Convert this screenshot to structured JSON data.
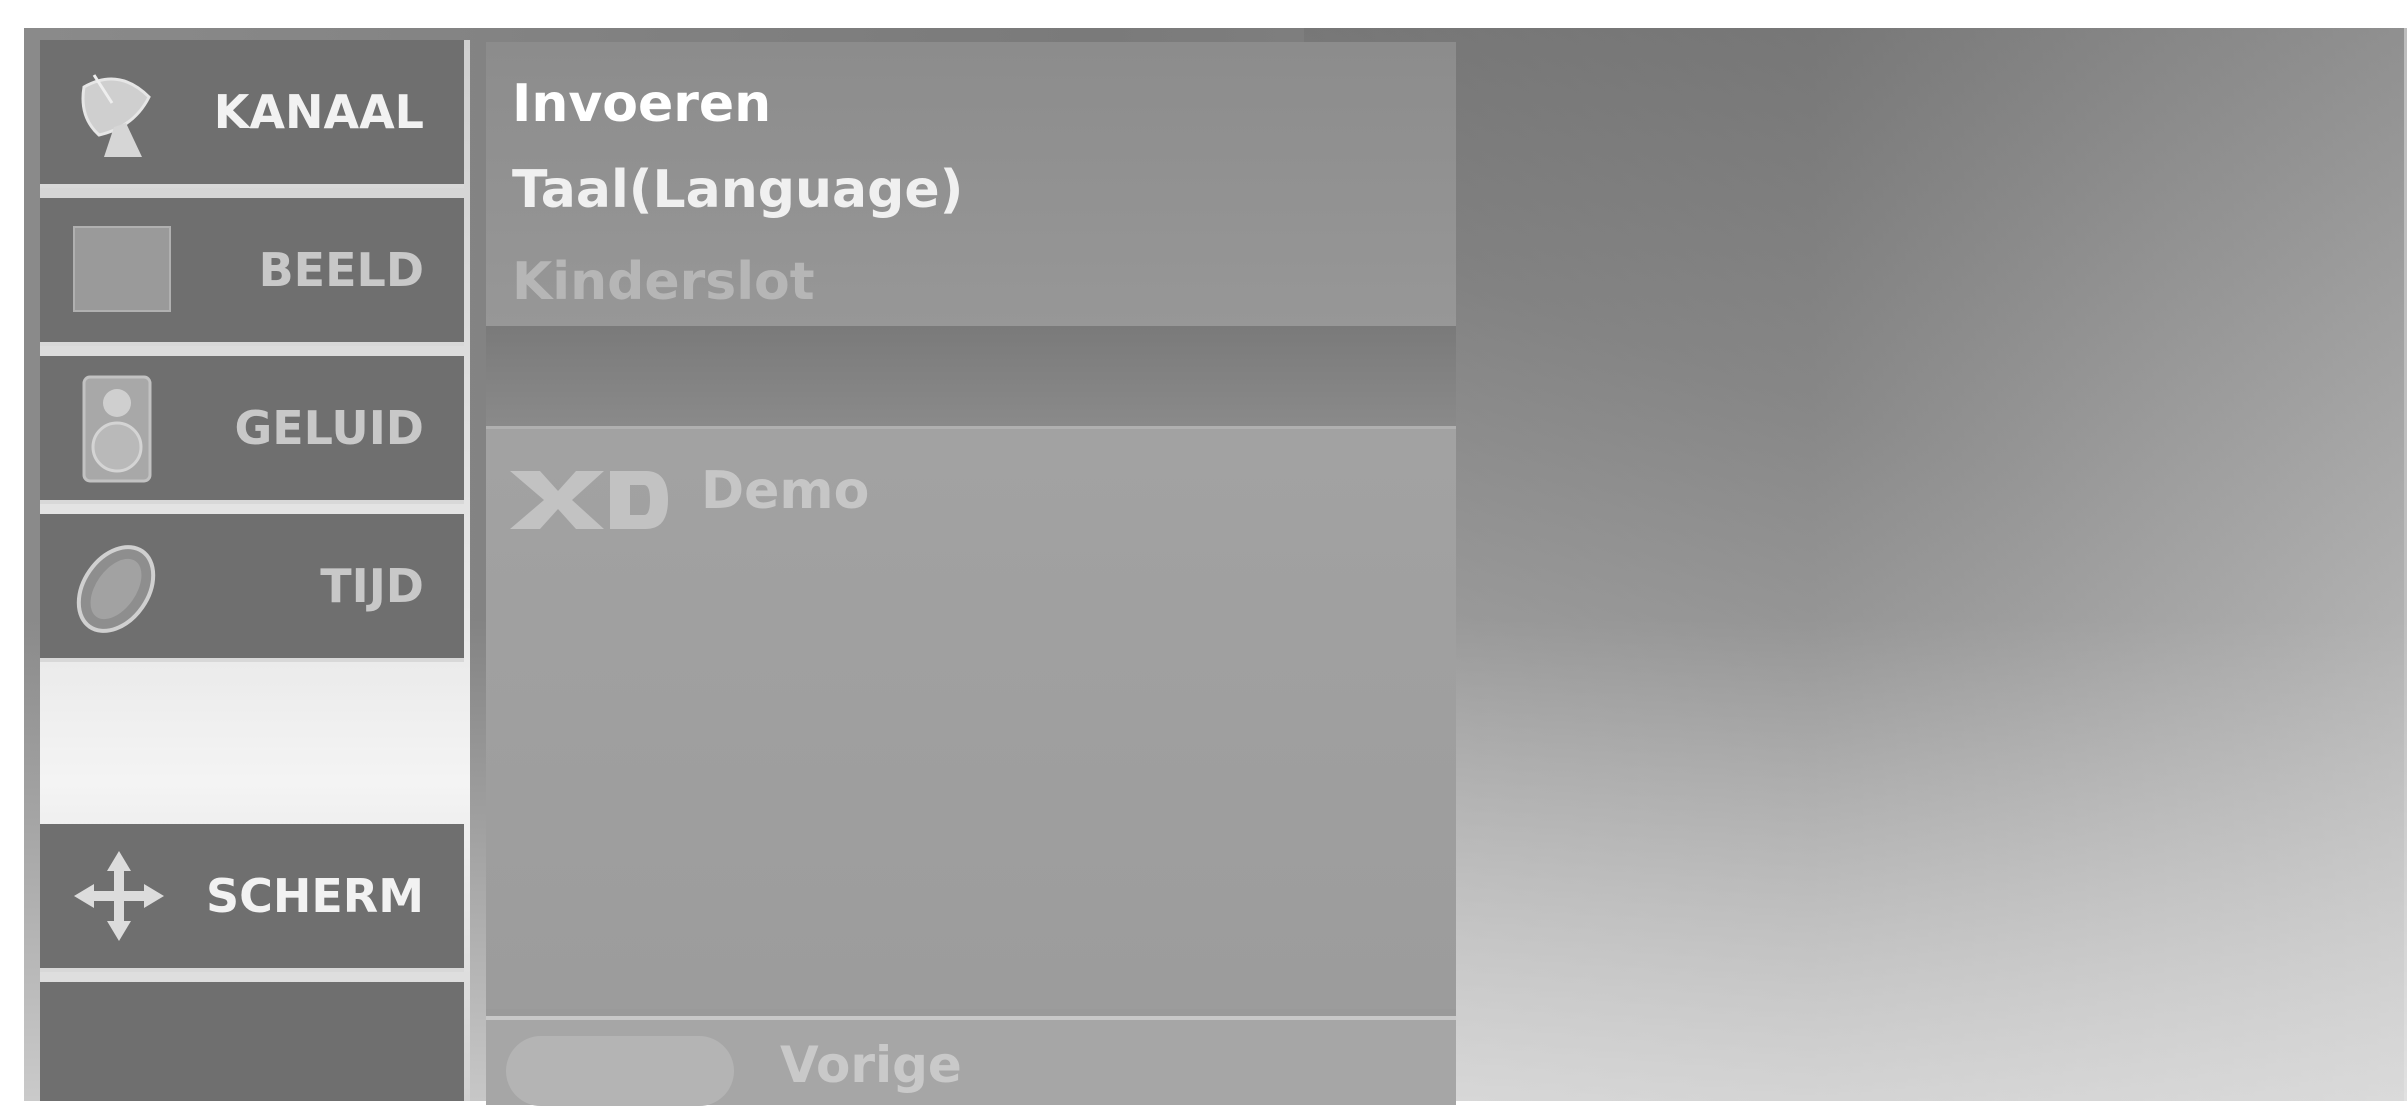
{
  "sidebar": {
    "items": [
      {
        "label": "KANAAL",
        "icon": "satellite-dish-icon"
      },
      {
        "label": "BEELD",
        "icon": "picture-square-icon"
      },
      {
        "label": "GELUID",
        "icon": "speaker-icon"
      },
      {
        "label": "TIJD",
        "icon": "clock-globe-icon"
      },
      {
        "label": "SCHERM",
        "icon": "move-arrows-icon"
      }
    ]
  },
  "submenu": {
    "items": [
      "Invoeren",
      "Taal(Language)",
      "Kinderslot"
    ],
    "demo_label": "Demo",
    "demo_logo": "XD"
  },
  "footer": {
    "prev_label": "Vorige"
  }
}
